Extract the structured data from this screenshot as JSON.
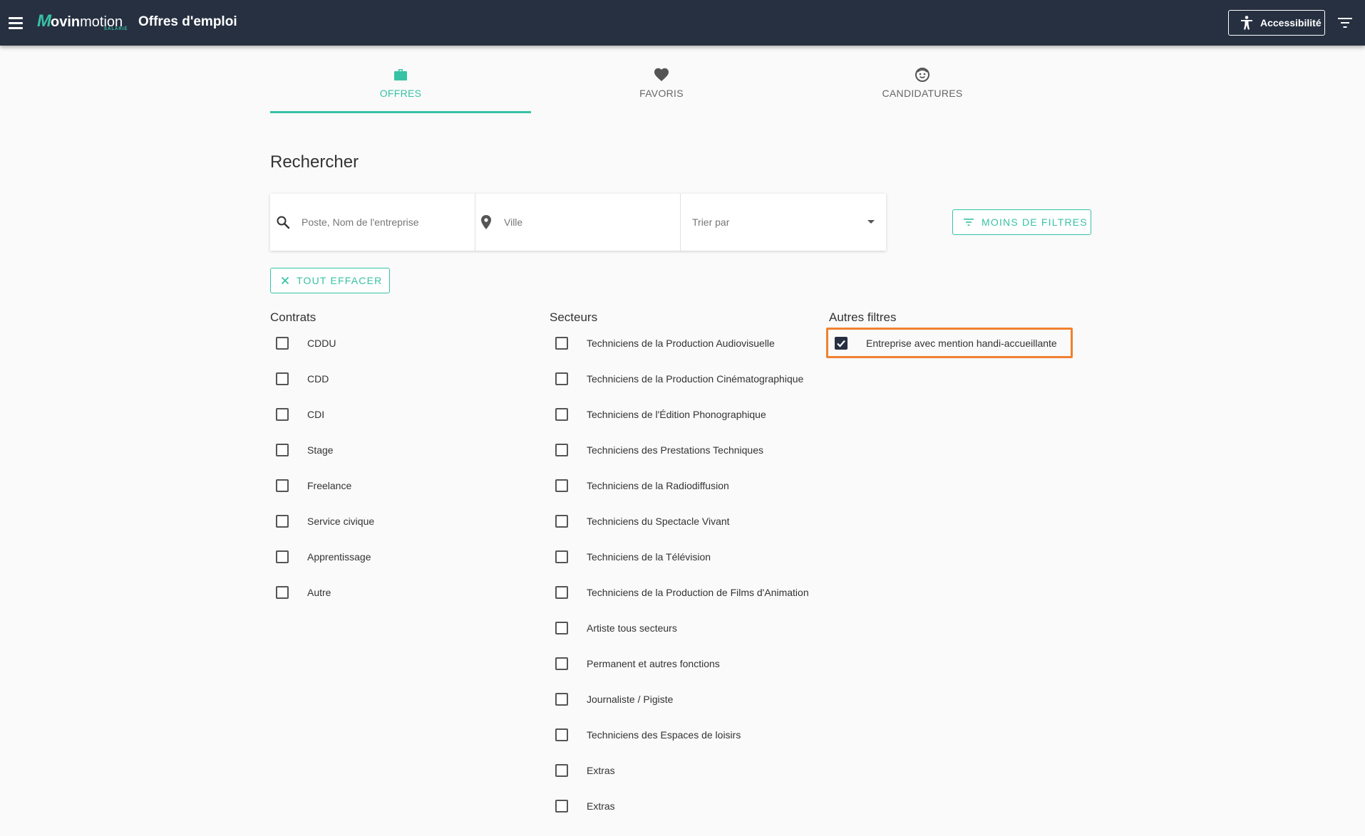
{
  "header": {
    "logo_mark": "M",
    "logo_bold": "ovin",
    "logo_light": "motion",
    "logo_sub": "SALARIÉ",
    "title": "Offres d'emploi",
    "accessibility_label": "Accessibilité"
  },
  "tabs": [
    {
      "label": "OFFRES",
      "icon": "briefcase-icon",
      "active": true
    },
    {
      "label": "FAVORIS",
      "icon": "heart-icon",
      "active": false
    },
    {
      "label": "CANDIDATURES",
      "icon": "smiley-icon",
      "active": false
    }
  ],
  "search": {
    "title": "Rechercher",
    "query_placeholder": "Poste, Nom de l'entreprise",
    "city_placeholder": "Ville",
    "sort_label": "Trier par",
    "less_filters_label": "MOINS DE FILTRES",
    "clear_all_label": "TOUT EFFACER"
  },
  "filters": {
    "contrats": {
      "title": "Contrats",
      "options": [
        "CDDU",
        "CDD",
        "CDI",
        "Stage",
        "Freelance",
        "Service civique",
        "Apprentissage",
        "Autre"
      ]
    },
    "secteurs": {
      "title": "Secteurs",
      "options": [
        "Techniciens de la Production Audiovisuelle",
        "Techniciens de la Production Cinématographique",
        "Techniciens de l'Édition Phonographique",
        "Techniciens des Prestations Techniques",
        "Techniciens de la Radiodiffusion",
        "Techniciens du Spectacle Vivant",
        "Techniciens de la Télévision",
        "Techniciens de la Production de Films d'Animation",
        "Artiste tous secteurs",
        "Permanent et autres fonctions",
        "Journaliste / Pigiste",
        "Techniciens des Espaces de loisirs",
        "Extras",
        "Extras"
      ]
    },
    "autres": {
      "title": "Autres filtres",
      "options": [
        "Entreprise avec mention handi-accueillante"
      ],
      "checked": [
        true
      ]
    }
  },
  "colors": {
    "header_bg": "#263040",
    "accent": "#37c2a4",
    "highlight": "#f08030"
  }
}
